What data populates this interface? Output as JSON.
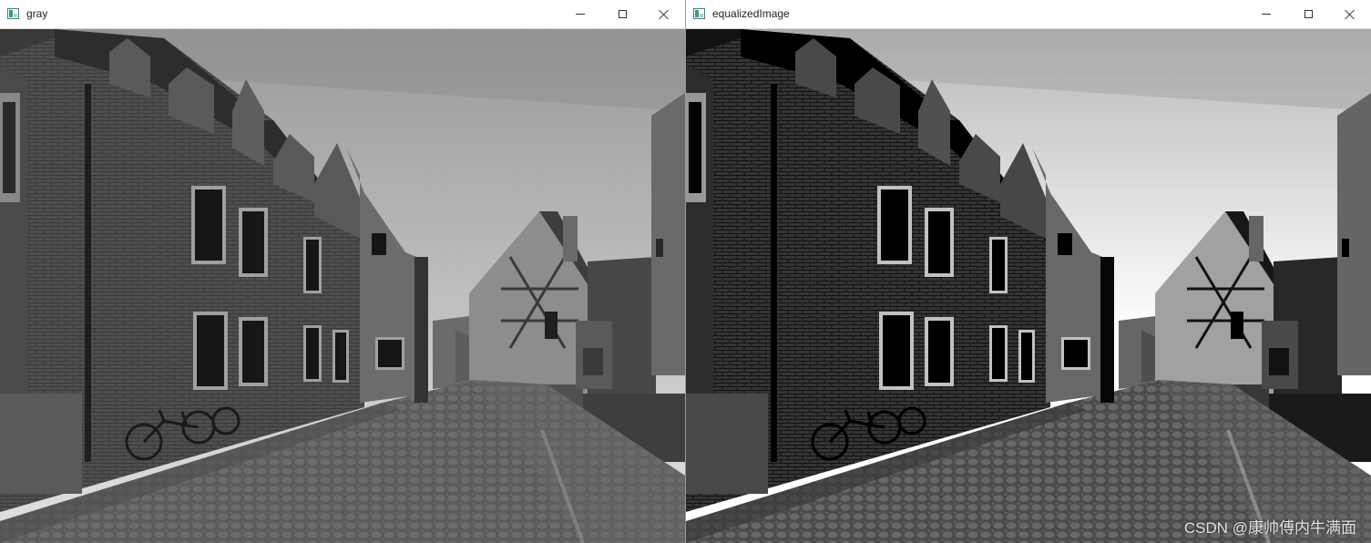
{
  "windows": [
    {
      "title": "gray"
    },
    {
      "title": "equalizedImage"
    }
  ],
  "controls": {
    "minimize_icon": "minimize-icon",
    "maximize_icon": "maximize-icon",
    "close_icon": "close-icon"
  },
  "watermark": "CSDN @康帅傅内牛满面",
  "colors": {
    "titlebar": "#ffffff",
    "window_border": "#999999"
  }
}
